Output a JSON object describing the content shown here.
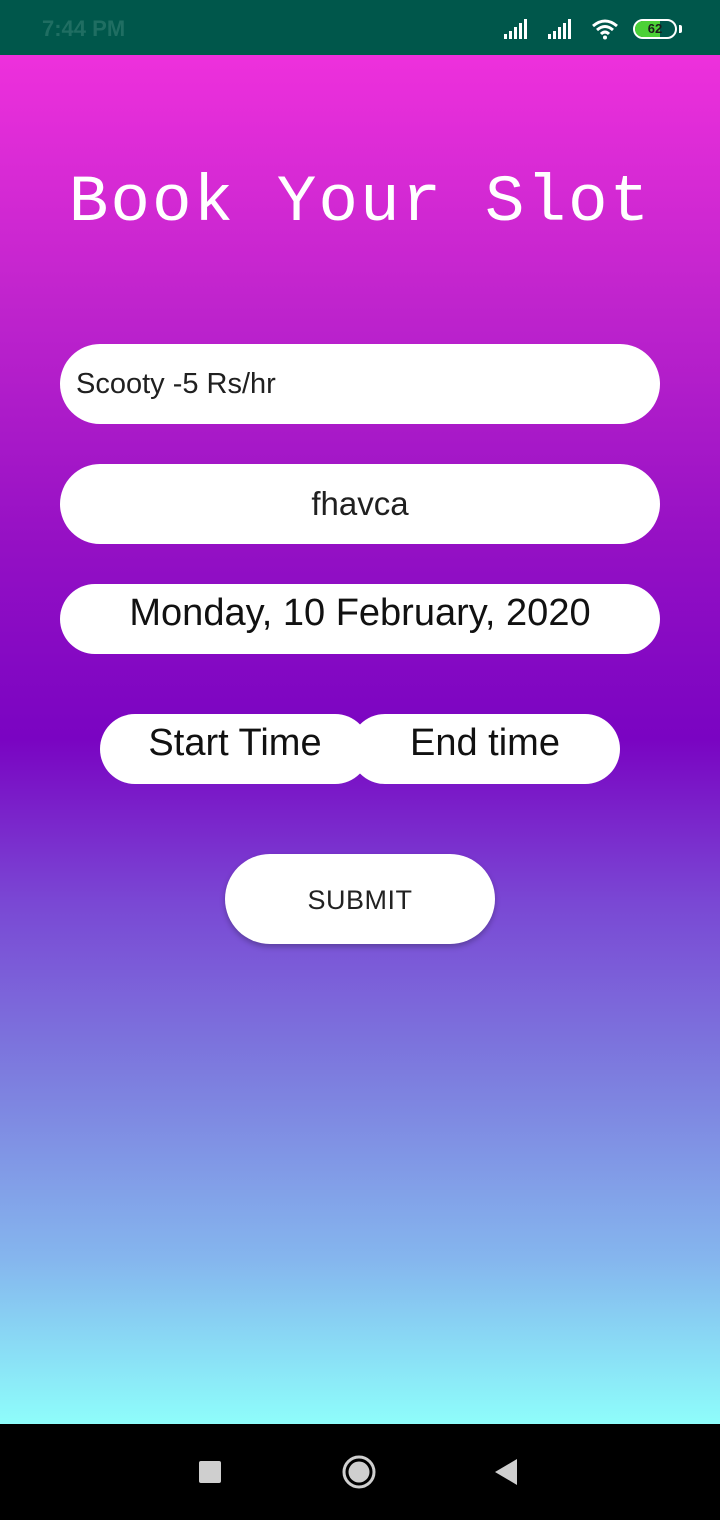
{
  "status_bar": {
    "time": "7:44 PM",
    "battery_level": "62",
    "battery_fraction": 0.62,
    "icons": [
      "signal-icon",
      "signal-icon",
      "wifi-icon",
      "battery-icon"
    ]
  },
  "page": {
    "title": "Book Your Slot"
  },
  "form": {
    "vehicle_value": "Scooty -5 Rs/hr",
    "name_value": "fhavca",
    "date_value": "Monday, 10 February, 2020",
    "start_time_label": "Start Time",
    "end_time_label": "End time",
    "submit_label": "SUBMIT"
  },
  "nav_bar": {
    "icons": [
      "recent-apps-icon",
      "home-icon",
      "back-icon"
    ]
  },
  "colors": {
    "status_bar": "#00574b",
    "gradient_top": "#ee30dc",
    "gradient_mid": "#7a04c2",
    "gradient_bottom": "#8efdfb",
    "nav_bar": "#000000"
  }
}
